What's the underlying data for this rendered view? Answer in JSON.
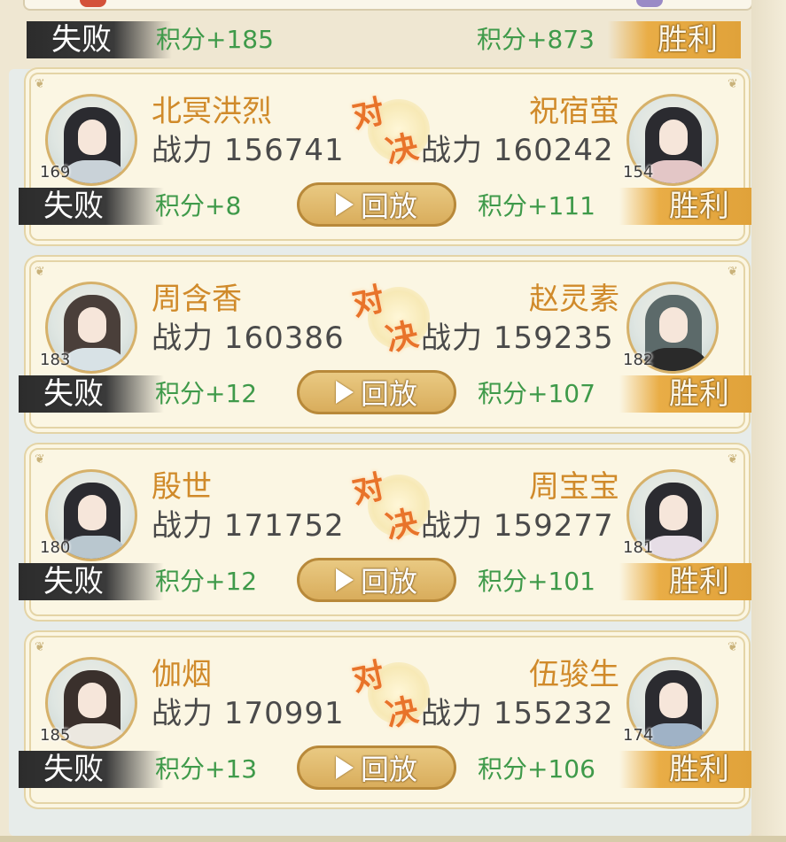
{
  "top": {
    "left_result": "失败",
    "left_score": "积分+185",
    "right_score": "积分+873",
    "right_result": "胜利"
  },
  "vs": {
    "c1": "对",
    "c2": "决"
  },
  "colors": {
    "win": "#e9ad46",
    "lose": "#333333",
    "score": "#3f9a4a",
    "name": "#d08a2a"
  },
  "matches": [
    {
      "left": {
        "name": "北冥洪烈",
        "power": "战力 156741",
        "level": "169",
        "result": "失败",
        "score": "积分+8"
      },
      "right": {
        "name": "祝宿萤",
        "power": "战力 160242",
        "level": "154",
        "result": "胜利",
        "score": "积分+111"
      },
      "replay": "回放"
    },
    {
      "left": {
        "name": "周含香",
        "power": "战力 160386",
        "level": "183",
        "result": "失败",
        "score": "积分+12"
      },
      "right": {
        "name": "赵灵素",
        "power": "战力 159235",
        "level": "182",
        "result": "胜利",
        "score": "积分+107"
      },
      "replay": "回放"
    },
    {
      "left": {
        "name": "殷世",
        "power": "战力 171752",
        "level": "180",
        "result": "失败",
        "score": "积分+12"
      },
      "right": {
        "name": "周宝宝",
        "power": "战力 159277",
        "level": "181",
        "result": "胜利",
        "score": "积分+101"
      },
      "replay": "回放"
    },
    {
      "left": {
        "name": "伽烟",
        "power": "战力 170991",
        "level": "185",
        "result": "失败",
        "score": "积分+13"
      },
      "right": {
        "name": "伍骏生",
        "power": "战力 155232",
        "level": "174",
        "result": "胜利",
        "score": "积分+106"
      },
      "replay": "回放"
    }
  ]
}
